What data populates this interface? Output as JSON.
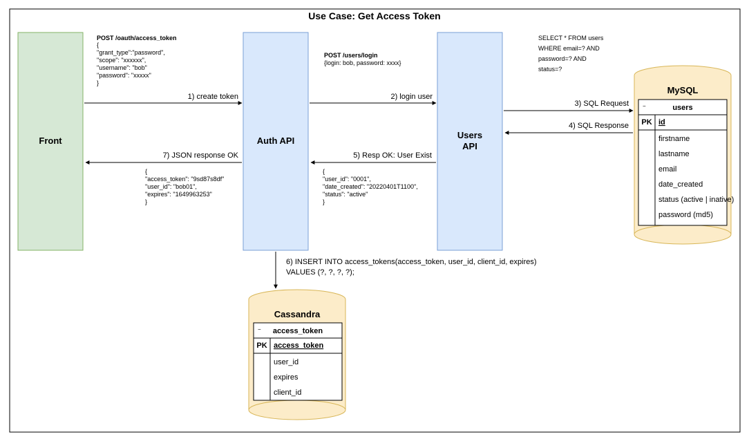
{
  "title": "Use Case: Get Access Token",
  "boxes": {
    "front": "Front",
    "auth": "Auth API",
    "users": "Users\nAPI",
    "mysql_title": "MySQL",
    "cass_title": "Cassandra"
  },
  "arrow_labels": {
    "a1": "1) create token",
    "a2": "2) login user",
    "a3": "3) SQL Request",
    "a4": "4) SQL Response",
    "a5": "5) Resp OK: User Exist",
    "a6": "6) INSERT INTO access_tokens(access_token, user_id, client_id, expires)\nVALUES (?, ?, ?, ?);",
    "a7": "7) JSON response OK"
  },
  "payloads": {
    "post1_head": "POST /oauth/access_token",
    "post1_body": "{\n  \"grant_type\":\"password\",\n  \"scope\": \"xxxxxx\",\n  \"username\": \"bob\"\n  \"password\": \"xxxxx\"\n}",
    "post2_head": "POST /users/login",
    "post2_body": "{login: bob, password: xxxx}",
    "sql_select": "SELECT * FROM users\nWHERE email=? AND\npassword=? AND\nstatus=?",
    "resp5": "{\n  \"user_id\": \"0001\",\n  \"date_created\": \"20220401T1100\",\n  \"status\": \"active\"\n}",
    "resp7": "{\n  \"access_token\": \"9sd87s8df\"\n  \"user_id\": \"bob01\",\n  \"expires\": \"1649963253\"\n}"
  },
  "mysql_table": {
    "name": "users",
    "pk": "id",
    "cols": [
      "firstname",
      "lastname",
      "email",
      "date_created",
      "status (active | inative)",
      "password (md5)"
    ]
  },
  "cass_table": {
    "name": "access_token",
    "pk": "access_token",
    "cols": [
      "user_id",
      "expires",
      "client_id"
    ]
  },
  "pk_label": "PK"
}
